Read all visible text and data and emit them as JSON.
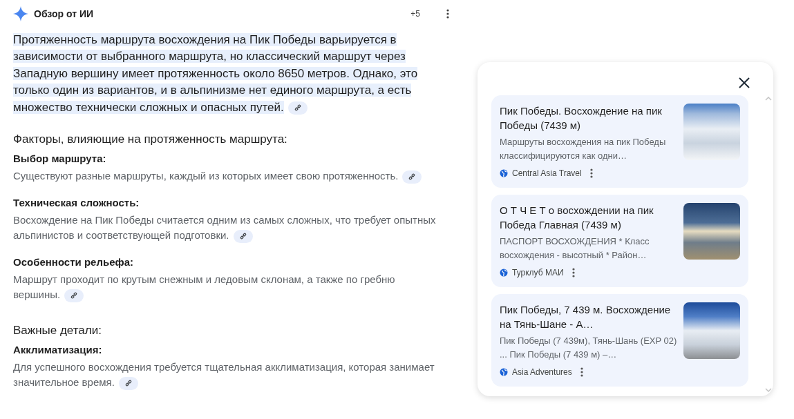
{
  "header": {
    "title": "Обзор от ИИ",
    "extra_count": "+5"
  },
  "intro": {
    "text": "Протяженность маршрута восхождения на Пик Победы варьируется в зависимости от выбранного маршрута, но классический маршрут через Западную вершину имеет протяженность около 8650 метров. Однако, это только один из вариантов, и в альпинизме нет единого маршрута, а есть множество технически сложных и опасных путей.",
    "highlighted": true
  },
  "sections": [
    {
      "heading": "Факторы, влияющие на протяженность маршрута:",
      "items": [
        {
          "title": "Выбор маршрута:",
          "text": "Существуют разные маршруты, каждый из которых имеет свою протяженность."
        },
        {
          "title": "Техническая сложность:",
          "text": "Восхождение на Пик Победы считается одним из самых сложных, что требует опытных альпинистов и соответствующей подготовки."
        },
        {
          "title": "Особенности рельефа:",
          "text": "Маршрут проходит по крутым снежным и ледовым склонам, а также по гребню вершины."
        }
      ]
    },
    {
      "heading": "Важные детали:",
      "items": [
        {
          "title": "Акклиматизация:",
          "text": "Для успешного восхождения требуется тщательная акклиматизация, которая занимает значительное время."
        }
      ]
    }
  ],
  "sources": [
    {
      "title": "Пик Победы. Восхождение на пик Победы (7439 м)",
      "snippet": "Маршруты восхождения на пик Победы классифицируются как одни…",
      "site": "Central Asia Travel"
    },
    {
      "title": "О Т Ч Е Т о восхождении на пик Победа Главная (7439 м)",
      "snippet": "ПАСПОРТ ВОСХОЖДЕНИЯ * Класс восхождения - высотный * Район…",
      "site": "Турклуб МАИ"
    },
    {
      "title": "Пик Победы, 7 439 м. Восхождение на Тянь-Шане - А…",
      "snippet": "Пик Победы (7 439м), Тянь-Шань (EXP 02) ... Пик Победы (7 439 м) –…",
      "site": "Asia Adventures"
    }
  ]
}
